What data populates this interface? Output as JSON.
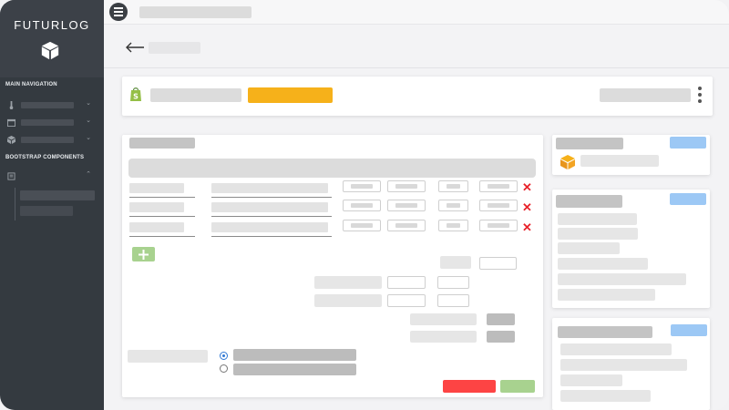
{
  "app": {
    "brand": "FUTURLOG"
  },
  "sidebar": {
    "sections": [
      {
        "label": "MAIN NAVIGATION"
      },
      {
        "label": "BOOTSTRAP COMPONENTS"
      }
    ],
    "nav_icons": [
      "thermometer-icon",
      "calendar-icon",
      "box-icon"
    ],
    "component_icons": [
      "square-icon"
    ]
  },
  "header": {
    "back_icon": "arrow-left-icon",
    "menu_icon": "hamburger-icon"
  },
  "store_bar": {
    "shop_icon": "shopify-bag-icon",
    "menu_icon": "more-vertical-icon"
  },
  "line_items": {
    "remove_icon": "close-x-icon",
    "add_icon": "plus-icon",
    "rows": 3
  },
  "radio_options": [
    {
      "checked": true
    },
    {
      "checked": false
    }
  ],
  "colors": {
    "sidebar": "#343a40",
    "accent": "#f6b11a",
    "danger": "#fd4444",
    "success": "#a8d28f",
    "badge": "#9cc8f5",
    "remove_x": "#e8232b"
  }
}
